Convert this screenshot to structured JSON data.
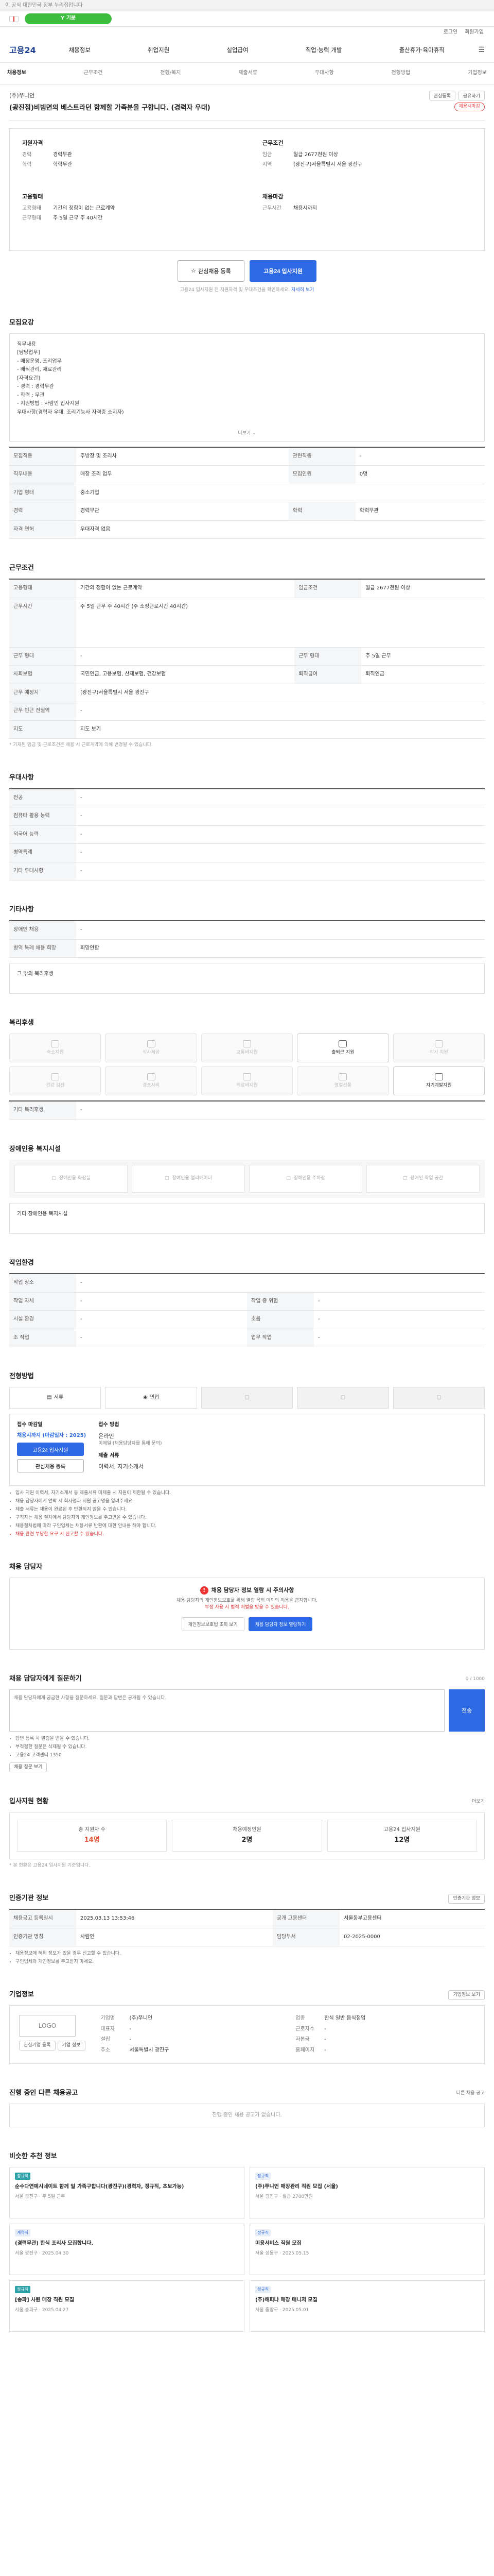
{
  "notice": "이 공식 대한민국 정부 누리집입니다",
  "gov": {
    "pill": "Y 기분",
    "text": ""
  },
  "util": [
    "로그인",
    "회원가입"
  ],
  "logo": {
    "text": "고용24"
  },
  "gnb": [
    "채용정보",
    "취업지원",
    "실업급여",
    "직업·능력 개발",
    "출산휴가·육아휴직"
  ],
  "subnav": [
    "채용정보",
    "근무조건",
    "전형/복지",
    "제출서류",
    "우대사항",
    "전형방법",
    "기업정보"
  ],
  "company": "(주)쭈니언",
  "top_btns": [
    "관심등록",
    "공유하기"
  ],
  "title": "(광진점)비빔면의 베스트라던 함께할 가족분을 구합니다. (경력자 우대)",
  "title_badge": "채용시마감",
  "summary": {
    "c1_h": "지원자격",
    "c1": [
      {
        "k": "경력",
        "v": "경력무관"
      },
      {
        "k": "학력",
        "v": "학력무관"
      }
    ],
    "c2_h": "근무조건",
    "c2": [
      {
        "k": "임금",
        "v": "월급 2677천원 이상"
      },
      {
        "k": "지역",
        "v": "(광진구)서울특별시 서울 광진구"
      }
    ],
    "c3_h": "고용형태",
    "c3": [
      {
        "k": "고용형태",
        "v": "기간의 정함이 없는 근로계약"
      },
      {
        "k": "근무형태",
        "v": "주 5일 근무 주 40시간"
      }
    ],
    "c4_h": "채용마감",
    "c4": [
      {
        "k": "근무시간",
        "v": "채용시까지"
      }
    ]
  },
  "apply": {
    "save_btn": "관심채용 등록",
    "apply_btn": "고용24 입사지원",
    "note": "고용24 입사지원 전 지원자격 및 우대조건을 확인하세요.",
    "note_link": "자세히 보기"
  },
  "job": {
    "h": "모집요강",
    "lines": [
      "직무내용",
      "",
      "[담당업무]",
      "- 매장운영, 조리업무",
      "- 배식관리, 재료관리",
      "",
      "[자격요건]",
      "- 경력 : 경력무관",
      "- 학력 : 무관",
      "- 지원방법 : 사람인 입사지원",
      "우대사항(경력자 우대, 조리기능사 자격증 소지자)"
    ],
    "more": "더보기"
  },
  "t1": [
    [
      {
        "k": "모집직종",
        "v": "주방장 및 조리사"
      },
      {
        "k": "관련직종",
        "v": "-"
      }
    ],
    [
      {
        "k": "직무내용",
        "v": "매장 조리 업무"
      },
      {
        "k": "모집인원",
        "v": "0명"
      }
    ],
    [
      {
        "k": "기업 형태",
        "v": "중소기업"
      },
      {
        "k": "",
        "v": ""
      }
    ],
    [
      {
        "k": "경력",
        "v": "경력무관"
      },
      {
        "k": "학력",
        "v": "학력무관"
      }
    ],
    [
      {
        "k": "자격 면허",
        "v": "우대자격 없음"
      },
      {
        "k": "",
        "v": ""
      }
    ]
  ],
  "cond": {
    "h": "근무조건",
    "rows": [
      [
        {
          "k": "고용형태",
          "v": "기간의 정함이 없는 근로계약"
        },
        {
          "k": "임금조건",
          "v": "월급 2677천원 이상"
        }
      ],
      [
        {
          "k": "근무시간",
          "v": "주 5일 근무 주 40시간 (주 소정근로시간 40시간)"
        },
        {
          "k": "",
          "v": ""
        }
      ],
      [
        {
          "k": "근무 형태",
          "v": "-"
        },
        {
          "k": "근무 형태",
          "v": "주 5일 근무"
        }
      ],
      [
        {
          "k": "사회보험",
          "v": "국민연금, 고용보험, 산재보험, 건강보험"
        },
        {
          "k": "퇴직급여",
          "v": "퇴직연금"
        }
      ],
      [
        {
          "k": "근무 예정지",
          "v": "(광진구)서울특별시 서울 광진구"
        },
        {
          "k": "",
          "v": ""
        }
      ],
      [
        {
          "k": "근무 인근 전철역",
          "v": "-"
        },
        {
          "k": "",
          "v": ""
        }
      ],
      [
        {
          "k": "지도",
          "v": "지도 보기"
        },
        {
          "k": "",
          "v": ""
        }
      ]
    ],
    "note": "* 기재된 임금 및 근로조건은 채용 시 근로계약에 의해 변경될 수 있습니다."
  },
  "pref": {
    "h": "우대사항",
    "rows": [
      {
        "k": "전공",
        "v": "-"
      },
      {
        "k": "컴퓨터 활용 능력",
        "v": "-"
      },
      {
        "k": "외국어 능력",
        "v": "-"
      },
      {
        "k": "병역특례",
        "v": "-"
      },
      {
        "k": "기타 우대사항",
        "v": "-"
      }
    ]
  },
  "etc": {
    "h": "기타사항",
    "rows": [
      {
        "k": "장애인 채용",
        "v": "-"
      },
      {
        "k": "병역 특례 채용 희망",
        "v": "희망안함"
      }
    ],
    "box": "그 밖의 복리후생"
  },
  "welfare": {
    "h": "복리후생",
    "items": [
      "숙소지원",
      "식사제공",
      "교통비지원",
      "출퇴근 지원",
      "의사 지원",
      "건강 검진",
      "경조사비",
      "의료비지원",
      "명절선물",
      "자기계발지원"
    ],
    "on": [
      3,
      9
    ],
    "extra_h": "기타 복리후생",
    "extra_v": "-"
  },
  "disab": {
    "h": "장애인용 복지시설",
    "items": [
      "장애인용 화장실",
      "장애인용 엘리베이터",
      "장애인용 주차장",
      "장애인 작업 공간"
    ],
    "extra": "기타 장애인용 복지시설"
  },
  "env": {
    "h": "작업환경",
    "rows": [
      [
        {
          "k": "작업 장소",
          "v": "-"
        },
        {
          "k": "",
          "v": ""
        }
      ],
      [
        {
          "k": "작업 자세",
          "v": "-"
        },
        {
          "k": "작업 중 위험",
          "v": "-"
        }
      ],
      [
        {
          "k": "시설 환경",
          "v": "-"
        },
        {
          "k": "소음",
          "v": "-"
        }
      ],
      [
        {
          "k": "조 작업",
          "v": "-"
        },
        {
          "k": "업무 작업",
          "v": "-"
        }
      ]
    ]
  },
  "proc": {
    "h": "전형방법",
    "steps": [
      "서류",
      "면접",
      "",
      "",
      ""
    ]
  },
  "applyinfo": {
    "col1_h": "접수 마감일",
    "col1_v": "채용시까지 (마감일자 : 2025)",
    "col1_btn1": "고용24 입사지원",
    "col1_btn2": "관심채용 등록",
    "col2_h": "접수 방법",
    "col2_v": "온라인",
    "col2_note": "이메일 (채용담당자를 통해 문의)",
    "col3_h": "제출 서류",
    "col3_v": "이력서, 자기소개서",
    "bullets": [
      "입사 지원 이력서, 자기소개서 등 제출서류 미제출 시 지원이 제한될 수 있습니다.",
      "채용 담당자에게 연락 시 회사명과 지원 공고명을 알려주세요.",
      "제출 서류는 채용이 완료된 후 반환되지 않을 수 있습니다.",
      "구직자는 채용 절차에서 담당자와 개인정보를 주고받을 수 있습니다.",
      "채용절차법에 따라 구인업체는 채용서류 반환에 대한 안내를 해야 합니다."
    ],
    "red_bullet": "채용 관련 부당한 요구 시 신고할 수 있습니다."
  },
  "mgr": {
    "h": "채용 담당자",
    "warn": "채용 담당자 정보 열람 시 주의사항",
    "sub": "채용 담당자의 개인정보보호를 위해 열람 목적 이외의 이용을 금지합니다.",
    "sub_red": "부정 사용 시 법적 처벌을 받을 수 있습니다.",
    "btn1": "개인정보보호법 조회 보기",
    "btn2": "채용 담당자 정보 열람하기"
  },
  "inq": {
    "h": "채용 담당자에게 질문하기",
    "count": "0 / 1000",
    "placeholder": "채용 담당자에게 궁금한 사항을 질문하세요. 질문과 답변은 공개될 수 있습니다.",
    "btn": "전송",
    "bullets": [
      "답변 등록 시 알림을 받을 수 있습니다.",
      "부적절한 질문은 삭제될 수 있습니다.",
      "고용24 고객센터 1350"
    ],
    "more": "채용 질문 보기"
  },
  "stats": {
    "h": "입사지원 현황",
    "link": "더보기",
    "items": [
      {
        "label": "총 지원자 수",
        "num": "14명",
        "red": true
      },
      {
        "label": "채용예정인원",
        "num": "2명",
        "red": false
      },
      {
        "label": "고용24 입사지원",
        "num": "12명",
        "red": false
      }
    ],
    "note": "* 본 현황은 고용24 입사지원 기준입니다."
  },
  "reg": {
    "h": "인증기관 정보",
    "link": "인증기관 정보",
    "rows": [
      [
        {
          "k": "채용공고 등록일시",
          "v": "2025.03.13 13:53:46"
        },
        {
          "k": "공개 고용센터",
          "v": "서울동부고용센터"
        }
      ],
      [
        {
          "k": "인증기관 명칭",
          "v": "사람인"
        },
        {
          "k": "담당부서",
          "v": "02-2025-0000"
        }
      ]
    ],
    "bullets": [
      "채용정보에 허위 정보가 있을 경우 신고할 수 있습니다.",
      "구인업체와 개인정보를 주고받지 마세요."
    ]
  },
  "comp": {
    "h": "기업정보",
    "link": "기업정보 보기",
    "logo": "LOGO",
    "rows": [
      {
        "k": "기업명",
        "v": "(주)쭈니언"
      },
      {
        "k": "업종",
        "v": "한식 일반 음식점업"
      },
      {
        "k": "대표자",
        "v": "-"
      },
      {
        "k": "근로자수",
        "v": "-"
      },
      {
        "k": "설립",
        "v": "-"
      },
      {
        "k": "자본금",
        "v": "-"
      },
      {
        "k": "주소",
        "v": "서울특별시 광진구"
      },
      {
        "k": "홈페이지",
        "v": "-"
      }
    ],
    "btn1": "관심기업 등록",
    "btn2": "기업 정보"
  },
  "other": {
    "h": "진행 중인 다른 채용공고",
    "empty": "진행 중인 채용 공고가 없습니다.",
    "link": "다른 채용 공고"
  },
  "rec": {
    "h": "비슷한 추천 정보",
    "items": [
      {
        "tag": "정규직",
        "t": "순수다연예시네이트 함께 일 가족구합니다(광진구)(경력자, 정규직, 초보가능)",
        "m": "서울 광진구 · 주 5일 근무"
      },
      {
        "tag": "정규직",
        "t": "(주)쭈니언 매장관리 직원 모집 (서울)",
        "m": "서울 광진구 · 월급 2700만원"
      },
      {
        "tag": "계약직",
        "t": "(경력무관) 한식 조리사 모집합니다.",
        "m": "서울 광진구 · 2025.04.30"
      },
      {
        "tag": "정규직",
        "t": "미용서비스 직원 모집",
        "m": "서울 성동구 · 2025.05.15"
      },
      {
        "tag": "정규직",
        "t": "[송파] 사원 매장 직원 모집",
        "m": "서울 송파구 · 2025.04.27"
      },
      {
        "tag": "정규직",
        "t": "(주)해피나 매장 매니저 모집",
        "m": "서울 중랑구 · 2025.05.01"
      }
    ]
  }
}
